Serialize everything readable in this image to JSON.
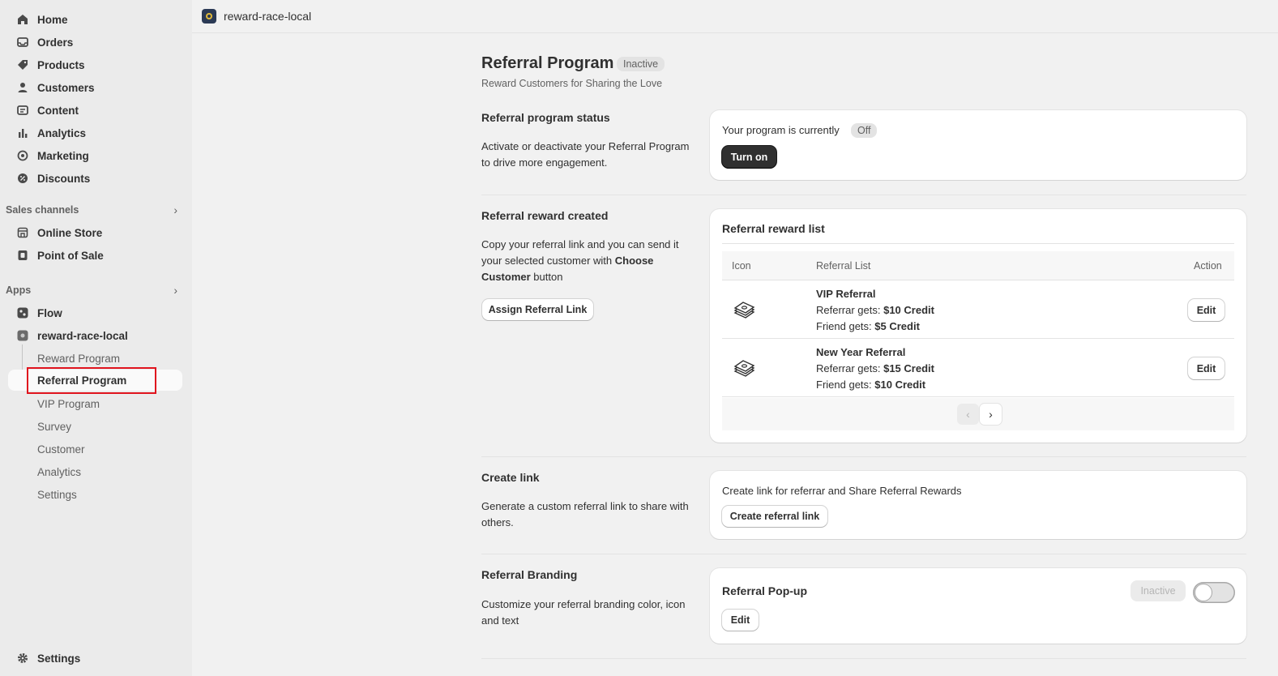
{
  "sidebar": {
    "main_items": [
      {
        "label": "Home",
        "icon": "home-icon"
      },
      {
        "label": "Orders",
        "icon": "inbox-icon"
      },
      {
        "label": "Products",
        "icon": "tag-icon"
      },
      {
        "label": "Customers",
        "icon": "person-icon"
      },
      {
        "label": "Content",
        "icon": "content-icon"
      },
      {
        "label": "Analytics",
        "icon": "bar-chart-icon"
      },
      {
        "label": "Marketing",
        "icon": "target-icon"
      },
      {
        "label": "Discounts",
        "icon": "discount-icon"
      }
    ],
    "sales_channels": {
      "label": "Sales channels",
      "items": [
        {
          "label": "Online Store",
          "icon": "store-icon"
        },
        {
          "label": "Point of Sale",
          "icon": "pos-icon"
        }
      ]
    },
    "apps": {
      "label": "Apps",
      "items": [
        {
          "label": "Flow",
          "icon": "flow-icon"
        },
        {
          "label": "reward-race-local",
          "icon": "app-icon"
        }
      ],
      "sub_items": [
        "Reward Program",
        "Referral Program",
        "VIP Program",
        "Survey",
        "Customer",
        "Analytics",
        "Settings"
      ],
      "active_sub_item": "Referral Program"
    },
    "settings_label": "Settings"
  },
  "topbar": {
    "app_name": "reward-race-local"
  },
  "page": {
    "title": "Referral Program",
    "status_badge": "Inactive",
    "subtitle": "Reward Customers for Sharing the Love"
  },
  "status_section": {
    "title": "Referral program status",
    "description": "Activate or deactivate your Referral Program to drive more engagement.",
    "card_text": "Your program is currently",
    "card_badge": "Off",
    "button_label": "Turn on"
  },
  "reward_section": {
    "title": "Referral reward created",
    "desc_part1": "Copy your referral link and you can send it your selected customer with ",
    "desc_bold": "Choose Customer",
    "desc_part2": " button",
    "button_label": "Assign Referral Link",
    "card_title": "Referral reward list",
    "columns": [
      "Icon",
      "Referral List",
      "Action"
    ],
    "rows": [
      {
        "name": "VIP Referral",
        "referrar_label": "Referrar gets: ",
        "referrar_value": "$10 Credit",
        "friend_label": "Friend gets: ",
        "friend_value": "$5 Credit",
        "action": "Edit",
        "icon": "money-stack-icon"
      },
      {
        "name": "New Year Referral",
        "referrar_label": "Referrar gets: ",
        "referrar_value": "$15 Credit",
        "friend_label": "Friend gets: ",
        "friend_value": "$10 Credit",
        "action": "Edit",
        "icon": "money-stack-icon"
      }
    ],
    "pager": {
      "prev": "‹",
      "next": "›"
    }
  },
  "create_link_section": {
    "title": "Create link",
    "description": "Generate a custom referral link to share with others.",
    "card_text": "Create link for referrar and Share Referral Rewards",
    "button_label": "Create referral link"
  },
  "branding_section": {
    "title": "Referral Branding",
    "description": "Customize your referral branding color, icon and text",
    "card_title": "Referral Pop-up",
    "badge": "Inactive",
    "toggle_on": false,
    "button_label": "Edit"
  },
  "colors": {
    "highlight": "#e0141e",
    "dark_button": "#303030",
    "background": "#f1f1f1"
  }
}
